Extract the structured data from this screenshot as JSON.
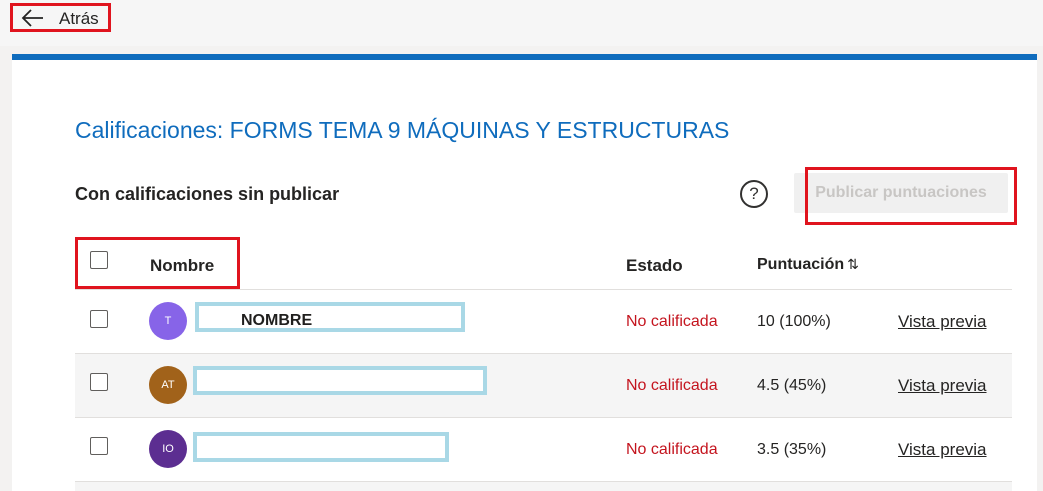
{
  "topbar": {
    "back_label": "Atrás"
  },
  "page": {
    "title": "Calificaciones: FORMS TEMA 9 MÁQUINAS Y ESTRUCTURAS",
    "subtitle": "Con calificaciones sin publicar",
    "help_glyph": "?",
    "publish_label": "Publicar puntuaciones"
  },
  "table": {
    "headers": {
      "name": "Nombre",
      "status": "Estado",
      "score": "Puntuación",
      "sort_glyph": "⇅"
    },
    "rows": [
      {
        "initials": "T",
        "avatar_color": "#8764e8",
        "name": "NOMBRE",
        "status": "No calificada",
        "score": "10 (100%)",
        "action": "Vista previa"
      },
      {
        "initials": "AT",
        "avatar_color": "#a1621a",
        "name": "",
        "status": "No calificada",
        "score": "4.5 (45%)",
        "action": "Vista previa"
      },
      {
        "initials": "IO",
        "avatar_color": "#5c2e91",
        "name": "",
        "status": "No calificada",
        "score": "3.5 (35%)",
        "action": "Vista previa"
      }
    ]
  },
  "colors": {
    "accent": "#0f6cbd",
    "highlight": "#e0141e",
    "status_red": "#c4141e",
    "name_box": "#a9d8e6"
  }
}
